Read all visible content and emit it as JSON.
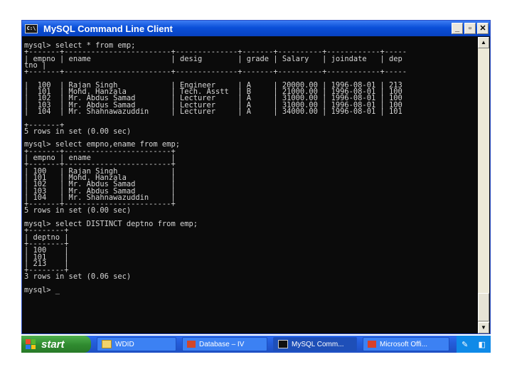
{
  "window": {
    "title": "MySQL Command Line Client",
    "controls": {
      "minimize": "_",
      "maximize": "▫",
      "close": "✕"
    }
  },
  "console": {
    "lines": [
      "mysql> select * from emp;",
      "+-------+------------------------+--------------+-------+----------+------------+-----",
      "| empno | ename                  | desig        | grade | Salary   | joindate   | dep",
      "tno |",
      "+-------+------------------------+--------------+-------+----------+------------+-----",
      "",
      "|  100  | Rajan Singh            | Engineer     | A     | 20000.00 | 1996-08-01 | 213",
      "|  101  | Mohd. Hanzala          | Tech. Asstt  | B     | 21000.00 | 1996-08-01 | 100",
      "|  102  | Mr. Abdus Samad        | Lecturer     | A     | 31000.00 | 1996-08-01 | 100",
      "|  103  | Mr. Abdus Samad        | Lecturer     | A     | 31000.00 | 1996-08-01 | 100",
      "|  104  | Mr. Shahnawazuddin     | Lecturer     | A     | 34000.00 | 1996-08-01 | 101",
      "",
      "+-------+",
      "5 rows in set (0.00 sec)",
      "",
      "mysql> select empno,ename from emp;",
      "+-------+------------------------+",
      "| empno | ename                  |",
      "+-------+------------------------+",
      "| 100   | Rajan Singh            |",
      "| 101   | Mohd. Hanzala          |",
      "| 102   | Mr. Abdus Samad        |",
      "| 103   | Mr. Abdus Samad        |",
      "| 104   | Mr. Shahnawazuddin     |",
      "+-------+------------------------+",
      "5 rows in set (0.00 sec)",
      "",
      "mysql> select DISTINCT deptno from emp;",
      "+--------+",
      "| deptno |",
      "+--------+",
      "| 100    |",
      "| 101    |",
      "| 213    |",
      "+--------+",
      "3 rows in set (0.06 sec)",
      "",
      "mysql> _"
    ]
  },
  "taskbar": {
    "start_label": "start",
    "tasks": [
      {
        "label": "WDID"
      },
      {
        "label": "Database – IV"
      },
      {
        "label": "MySQL Comm..."
      },
      {
        "label": "Microsoft Offi..."
      }
    ]
  },
  "colors": {
    "titlebar": "#0a4fd8",
    "console_bg": "#0b0b0b",
    "console_text": "#d6d6d6",
    "taskbar": "#245edb",
    "start": "#2f8a2f"
  }
}
